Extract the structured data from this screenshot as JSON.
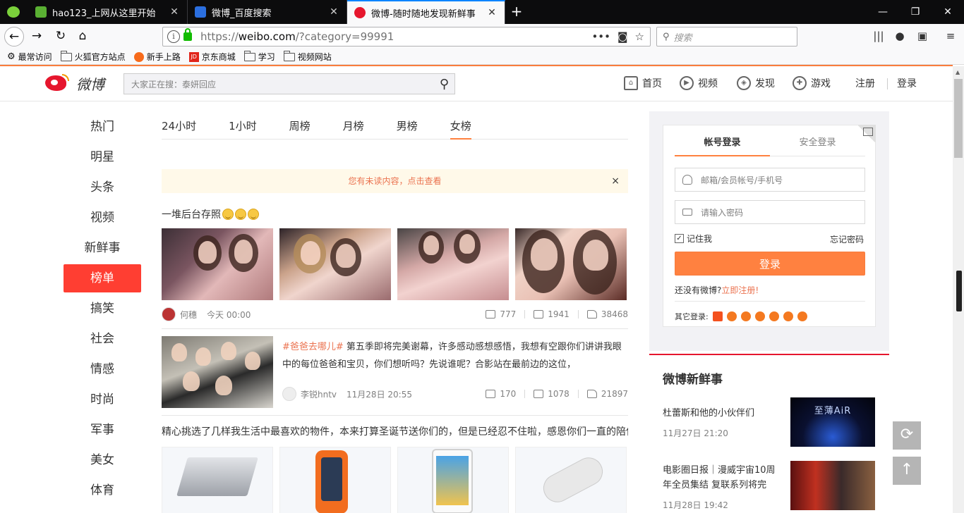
{
  "browser": {
    "tabs": [
      {
        "title": "hao123_上网从这里开始",
        "active": false
      },
      {
        "title": "微博_百度搜索",
        "active": false
      },
      {
        "title": "微博-随时随地发现新鲜事",
        "active": true
      }
    ],
    "url": {
      "prefix": "https://",
      "domain": "weibo.com",
      "path": "/?category=99991"
    },
    "search_placeholder": "搜索",
    "bookmarks": [
      "最常访问",
      "火狐官方站点",
      "新手上路",
      "京东商城",
      "学习",
      "视频网站"
    ]
  },
  "weibo": {
    "logo_text": "微博",
    "search_placeholder": "大家正在搜：泰妍回应",
    "nav": [
      "首页",
      "视频",
      "发现",
      "游戏",
      "注册",
      "登录"
    ],
    "left_nav": [
      "热门",
      "明星",
      "头条",
      "视频",
      "新鲜事",
      "榜单",
      "搞笑",
      "社会",
      "情感",
      "时尚",
      "军事",
      "美女",
      "体育"
    ],
    "left_nav_active": "榜单",
    "rank_tabs": [
      "24小时",
      "1小时",
      "周榜",
      "月榜",
      "男榜",
      "女榜"
    ],
    "rank_tab_active": "女榜",
    "unread_notice": "您有未读内容，点击查看",
    "close_symbol": "×",
    "posts": [
      {
        "text": "一堆后台存照",
        "author": "何穗",
        "time": "今天 00:00",
        "reposts": "777",
        "comments": "1941",
        "likes": "38468"
      },
      {
        "tag": "#爸爸去哪儿#",
        "text": " 第五季即将完美谢幕，许多感动感想感悟，我想有空跟你们讲讲我眼中的每位爸爸和宝贝，你们想听吗？先说谁呢？合影站在最前边的这位，",
        "author": "李锐hntv",
        "time": "11月28日 20:55",
        "reposts": "170",
        "comments": "1078",
        "likes": "21897"
      },
      {
        "text": "精心挑选了几样我生活中最喜欢的物件，本来打算圣诞节送你们的，但是已经忍不住啦，感恩你们一直的陪伴"
      }
    ],
    "login": {
      "tabs": [
        "帐号登录",
        "安全登录"
      ],
      "username_placeholder": "邮箱/会员帐号/手机号",
      "password_placeholder": "请输入密码",
      "remember": "记住我",
      "remember_checked": true,
      "forgot": "忘记密码",
      "submit": "登录",
      "register_prefix": "还没有微博?",
      "register_link": "立即注册!",
      "other_login": "其它登录:"
    },
    "fresh": {
      "title": "微博新鲜事",
      "items": [
        {
          "title": "杜蕾斯和他的小伙伴们",
          "date": "11月27日 21:20",
          "image_text": "至薄AiR"
        },
        {
          "title": "电影圈日报｜漫威宇宙10周年全员集结 复联系列将完",
          "date": "11月28日 19:42"
        }
      ]
    }
  },
  "colors": {
    "accent_orange": "#ff8140",
    "active_red": "#ff3e32",
    "weibo_red": "#e6162d",
    "link_orange": "#eb7350"
  }
}
